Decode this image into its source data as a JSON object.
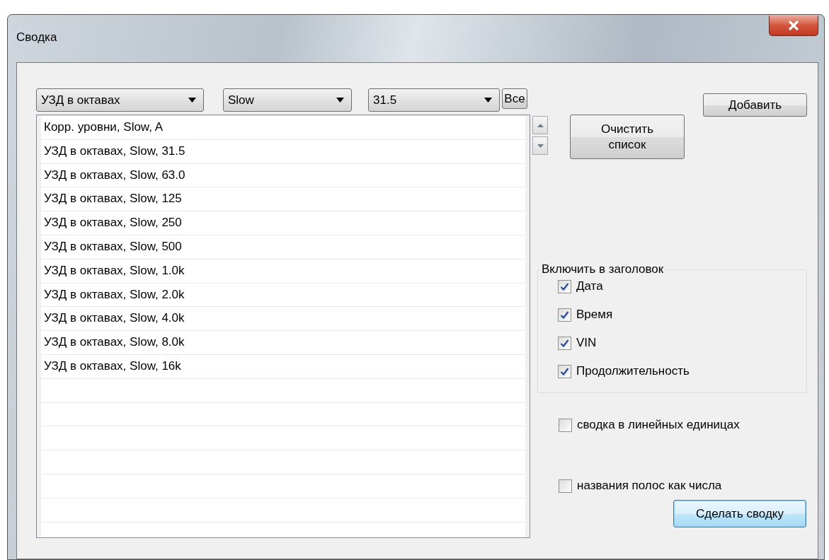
{
  "window": {
    "title": "Сводка"
  },
  "combos": [
    {
      "value": "УЗД в октавах"
    },
    {
      "value": "Slow"
    },
    {
      "value": "31.5"
    }
  ],
  "all_button": "Все",
  "add_button": "Добавить",
  "list": {
    "items": [
      "Корр. уровни, Slow, A",
      "УЗД в октавах, Slow, 31.5",
      "УЗД в октавах, Slow, 63.0",
      "УЗД в октавах, Slow, 125",
      "УЗД в октавах, Slow, 250",
      "УЗД в октавах, Slow, 500",
      "УЗД в октавах, Slow, 1.0k",
      "УЗД в октавах, Slow, 2.0k",
      "УЗД в октавах, Slow, 4.0k",
      "УЗД в октавах, Slow, 8.0k",
      "УЗД в октавах, Slow, 16k"
    ]
  },
  "clear_button": "Очистить список",
  "header_group": {
    "title": "Включить в заголовок",
    "options": [
      {
        "label": "Дата",
        "checked": true
      },
      {
        "label": "Время",
        "checked": true
      },
      {
        "label": "VIN",
        "checked": true
      },
      {
        "label": "Продолжительность",
        "checked": true
      }
    ]
  },
  "options": [
    {
      "label": "сводка в линейных единицах",
      "checked": false
    },
    {
      "label": "названия полос как числа",
      "checked": false
    }
  ],
  "make_button": "Сделать сводку"
}
